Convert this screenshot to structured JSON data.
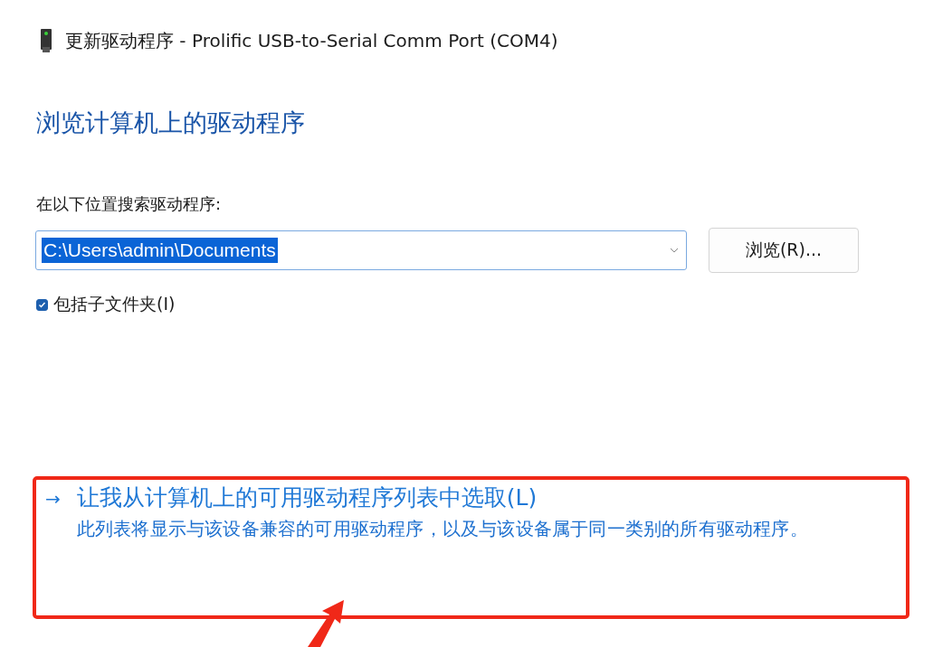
{
  "window": {
    "title": "更新驱动程序 - Prolific USB-to-Serial Comm Port (COM4)"
  },
  "heading": "浏览计算机上的驱动程序",
  "search_label": "在以下位置搜索驱动程序:",
  "path_field": {
    "value": "C:\\Users\\admin\\Documents"
  },
  "browse_button": "浏览(R)...",
  "include_subfolders": {
    "label": "包括子文件夹(I)",
    "checked": true
  },
  "pick_option": {
    "arrow": "→",
    "title": "让我从计算机上的可用驱动程序列表中选取(L)",
    "description": "此列表将显示与该设备兼容的可用驱动程序，以及与该设备属于同一类别的所有驱动程序。"
  }
}
